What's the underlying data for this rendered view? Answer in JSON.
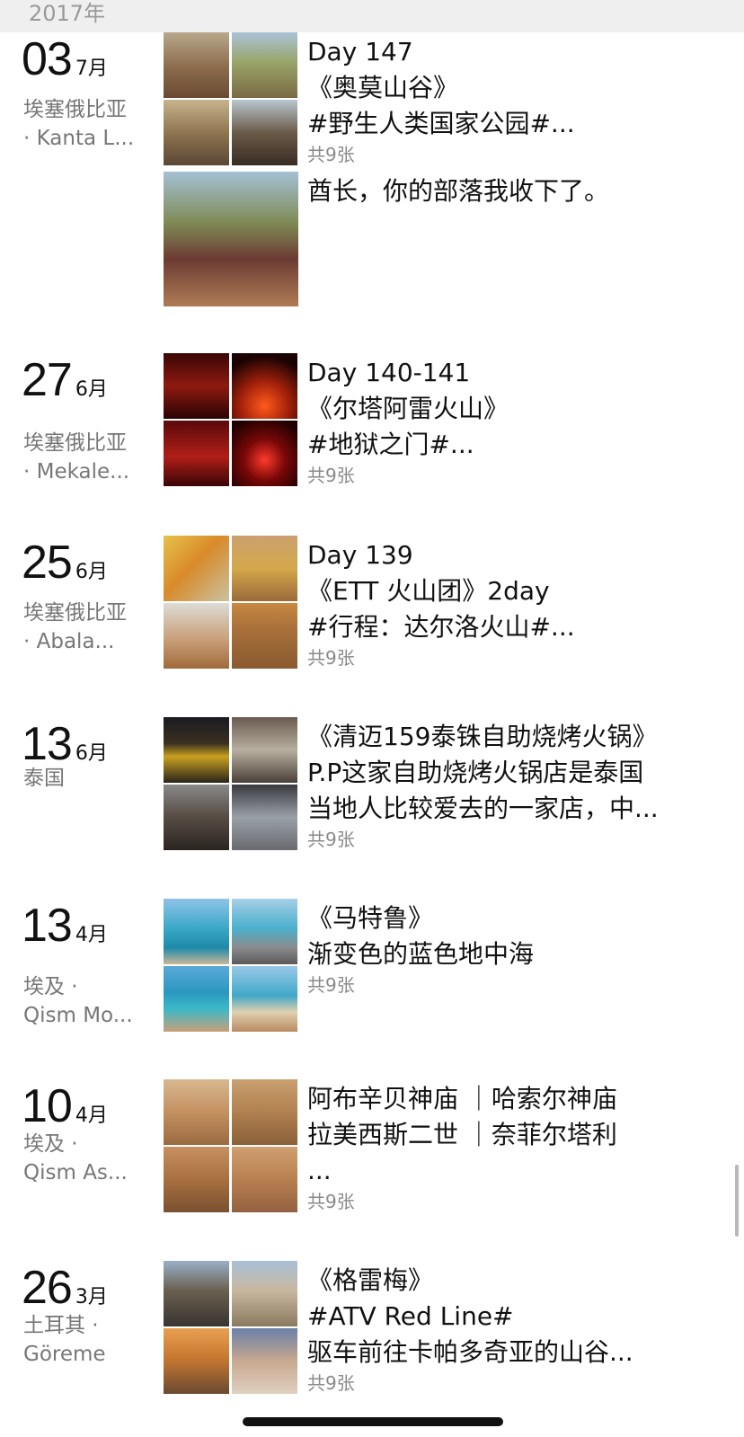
{
  "year_header": "2017年",
  "entries": [
    {
      "day": "03",
      "month": "7月",
      "loc1": "埃塞俄比亚",
      "loc2": "· Kanta L...",
      "lines": [
        "Day 147",
        "《奥莫山谷》",
        "#野生人类国家公园#..."
      ],
      "count": "共9张",
      "extra_caption": "酋长，你的部落我收下了。"
    },
    {
      "day": "27",
      "month": "6月",
      "loc1": "埃塞俄比亚",
      "loc2": "· Mekale...",
      "lines": [
        "Day 140-141",
        "《尔塔阿雷火山》",
        "#地狱之门#..."
      ],
      "count": "共9张"
    },
    {
      "day": "25",
      "month": "6月",
      "loc1": "埃塞俄比亚",
      "loc2": "· Abala...",
      "lines": [
        "Day 139",
        "《ETT 火山团》2day",
        "#行程：达尔洛火山#..."
      ],
      "count": "共9张"
    },
    {
      "day": "13",
      "month": "6月",
      "loc1": "泰国",
      "loc2": "",
      "lines": [
        "《清迈159泰铢自助烧烤火锅》",
        "P.P这家自助烧烤火锅店是泰国",
        "当地人比较爱去的一家店，中..."
      ],
      "count": "共9张"
    },
    {
      "day": "13",
      "month": "4月",
      "loc1": "埃及 ·",
      "loc2": "Qism Mo...",
      "lines": [
        "《马特鲁》",
        "渐变色的蓝色地中海",
        ""
      ],
      "count": "共9张"
    },
    {
      "day": "10",
      "month": "4月",
      "loc1": "埃及 ·",
      "loc2": "Qism As...",
      "lines": [
        "阿布辛贝神庙 ｜哈索尔神庙",
        "拉美西斯二世 ｜奈菲尔塔利",
        "..."
      ],
      "count": "共9张"
    },
    {
      "day": "26",
      "month": "3月",
      "loc1": "土耳其 ·",
      "loc2": "Göreme",
      "lines": [
        "《格雷梅》",
        "#ATV Red Line#",
        "驱车前往卡帕多奇亚的山谷..."
      ],
      "count": "共9张"
    }
  ]
}
